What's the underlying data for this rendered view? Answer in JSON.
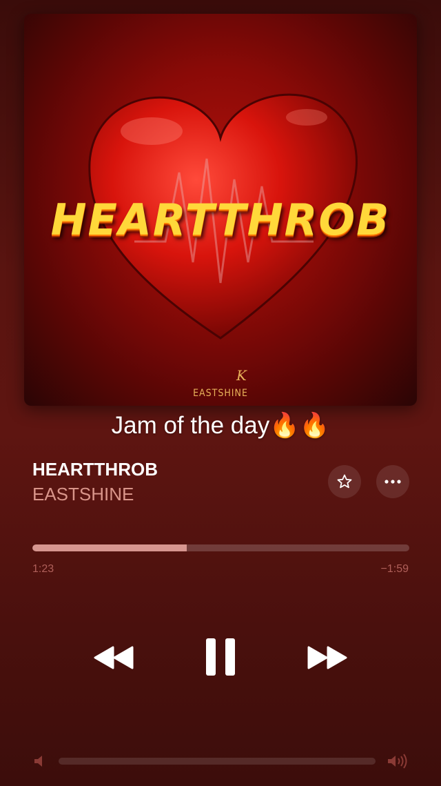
{
  "album_art": {
    "title_text": "HEARTTHROB",
    "artist_text": "EASTSHINE",
    "logo_text": "K"
  },
  "caption": "Jam of the day🔥🔥",
  "track": {
    "title": "HEARTTHROB",
    "artist": "EASTSHINE"
  },
  "actions": {
    "favorite_icon": "star-icon",
    "more_icon": "ellipsis-icon"
  },
  "playback": {
    "elapsed": "1:23",
    "remaining": "−1:59",
    "progress_fraction": 0.41
  },
  "controls": {
    "rewind_icon": "rewind-icon",
    "pause_icon": "pause-icon",
    "forward_icon": "fast-forward-icon"
  },
  "volume": {
    "min_icon": "volume-low-icon",
    "max_icon": "volume-high-icon"
  },
  "colors": {
    "accent": "#d79690",
    "artist_text": "#d9958a",
    "time_text": "#b0605a"
  }
}
